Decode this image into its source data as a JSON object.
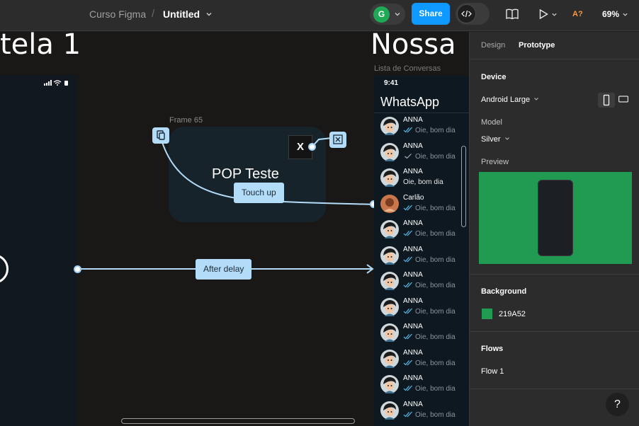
{
  "toolbar": {
    "project": "Curso Figma",
    "separator": "/",
    "file_name": "Untitled",
    "user_initial": "G",
    "share_label": "Share",
    "accessibility_label": "A?",
    "zoom": "69%"
  },
  "canvas": {
    "frame_left_title": "tela 1",
    "frame_right_title": "Nossa",
    "frame65_label": "Frame 65",
    "popup_title": "POP Teste",
    "close_glyph": "X",
    "interaction_touch": "Touch up",
    "interaction_delay": "After delay",
    "wa_frame_label": "Lista de Conversas",
    "whatsapp": {
      "time": "9:41",
      "title": "WhatsApp",
      "chats": [
        {
          "name": "ANNA",
          "message": "Oie, bom dia",
          "ticks": "double-blue"
        },
        {
          "name": "ANNA",
          "message": "Oie, bom dia",
          "ticks": "single-grey"
        },
        {
          "name": "ANNA",
          "message": "Oie, bom dia",
          "ticks": "none"
        },
        {
          "name": "Carlão",
          "message": "Oie, bom dia",
          "ticks": "double-blue"
        },
        {
          "name": "ANNA",
          "message": "Oie, bom dia",
          "ticks": "double-blue"
        },
        {
          "name": "ANNA",
          "message": "Oie, bom dia",
          "ticks": "double-blue"
        },
        {
          "name": "ANNA",
          "message": "Oie, bom dia",
          "ticks": "double-blue"
        },
        {
          "name": "ANNA",
          "message": "Oie, bom dia",
          "ticks": "double-blue"
        },
        {
          "name": "ANNA",
          "message": "Oie, bom dia",
          "ticks": "double-blue"
        },
        {
          "name": "ANNA",
          "message": "Oie, bom dia",
          "ticks": "double-blue"
        },
        {
          "name": "ANNA",
          "message": "Oie, bom dia",
          "ticks": "double-blue"
        },
        {
          "name": "ANNA",
          "message": "Oie, bom dia",
          "ticks": "double-blue"
        }
      ]
    }
  },
  "panel": {
    "tabs": [
      "Design",
      "Prototype"
    ],
    "active_tab": "Prototype",
    "device_title": "Device",
    "device_value": "Android Large",
    "model_label": "Model",
    "model_value": "Silver",
    "preview_label": "Preview",
    "background_title": "Background",
    "background_hex": "219A52",
    "flows_title": "Flows",
    "flows": [
      "Flow 1"
    ],
    "help_label": "?"
  },
  "colors": {
    "accent": "#0d99ff",
    "background_swatch": "#219a52",
    "wire": "#b3dcf9"
  }
}
